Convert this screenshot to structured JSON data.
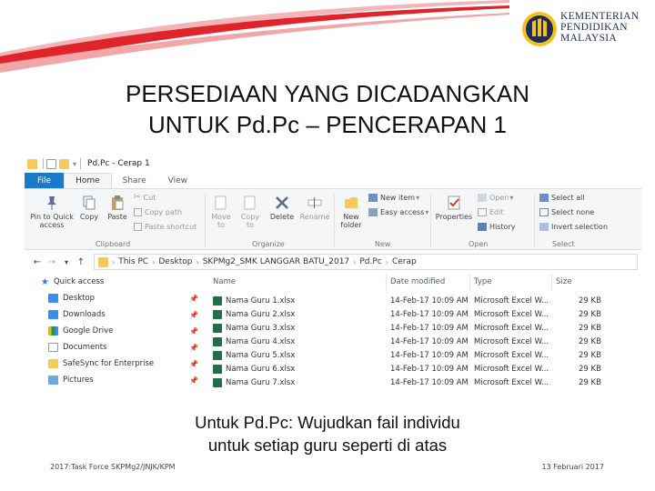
{
  "slide": {
    "title_line1": "PERSEDIAAN YANG DICADANGKAN",
    "title_line2": "UNTUK Pd.Pc – PENCERAPAN 1",
    "caption_line1": "Untuk Pd.Pc: Wujudkan fail individu",
    "caption_line2": "untuk setiap guru seperti di atas",
    "footer_left": "2017:Task Force SKPMg2/JNJK/KPM",
    "footer_right": "13 Februari 2017",
    "colors": {
      "accent_red": "#e0242b",
      "accent_pink": "#f2a6a8",
      "logo_blue": "#1f2a55",
      "logo_gold": "#f3c21b"
    }
  },
  "logo": {
    "line1": "KEMENTERIAN",
    "line2": "PENDIDIKAN",
    "line3": "MALAYSIA"
  },
  "explorer": {
    "window_title": "Pd.Pc - Cerap 1",
    "menu": {
      "file": "File",
      "home": "Home",
      "share": "Share",
      "view": "View"
    },
    "ribbon": {
      "pin": "Pin to Quick access",
      "copy": "Copy",
      "paste": "Paste",
      "cut": "Cut",
      "copy_path": "Copy path",
      "paste_shortcut": "Paste shortcut",
      "move_to": "Move to",
      "copy_to": "Copy to",
      "delete": "Delete",
      "rename": "Rename",
      "new_folder": "New folder",
      "new_item": "New item",
      "easy_access": "Easy access",
      "properties": "Properties",
      "open": "Open",
      "edit": "Edit",
      "history": "History",
      "select_all": "Select all",
      "select_none": "Select none",
      "invert_selection": "Invert selection",
      "groups": {
        "clipboard": "Clipboard",
        "organize": "Organize",
        "new": "New",
        "open": "Open",
        "select": "Select"
      }
    },
    "breadcrumb": [
      "This PC",
      "Desktop",
      "SKPMg2_SMK LANGGAR BATU_2017",
      "Pd.Pc",
      "Cerap"
    ],
    "nav": {
      "quick_access": "Quick access",
      "items": [
        "Desktop",
        "Downloads",
        "Google Drive",
        "Documents",
        "SafeSync for Enterprise",
        "Pictures"
      ]
    },
    "columns": {
      "name": "Name",
      "date": "Date modified",
      "type": "Type",
      "size": "Size"
    },
    "files": [
      {
        "name": "Nama Guru 1.xlsx",
        "date": "14-Feb-17 10:09 AM",
        "type": "Microsoft Excel W...",
        "size": "29 KB"
      },
      {
        "name": "Nama Guru 2.xlsx",
        "date": "14-Feb-17 10:09 AM",
        "type": "Microsoft Excel W...",
        "size": "29 KB"
      },
      {
        "name": "Nama Guru 3.xlsx",
        "date": "14-Feb-17 10:09 AM",
        "type": "Microsoft Excel W...",
        "size": "29 KB"
      },
      {
        "name": "Nama Guru 4.xlsx",
        "date": "14-Feb-17 10:09 AM",
        "type": "Microsoft Excel W...",
        "size": "29 KB"
      },
      {
        "name": "Nama Guru 5.xlsx",
        "date": "14-Feb-17 10:09 AM",
        "type": "Microsoft Excel W...",
        "size": "29 KB"
      },
      {
        "name": "Nama Guru 6.xlsx",
        "date": "14-Feb-17 10:09 AM",
        "type": "Microsoft Excel W...",
        "size": "29 KB"
      },
      {
        "name": "Nama Guru 7.xlsx",
        "date": "14-Feb-17 10:09 AM",
        "type": "Microsoft Excel W...",
        "size": "29 KB"
      }
    ]
  }
}
